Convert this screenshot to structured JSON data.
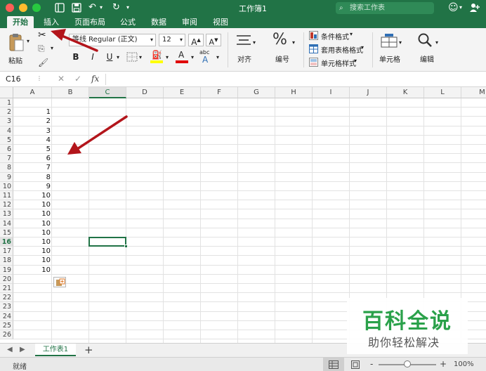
{
  "window": {
    "title": "工作簿1",
    "search_placeholder": "搜索工作表",
    "emoji_icon": "smiley-icon",
    "share_icon": "add-person-icon"
  },
  "tabs": [
    "开始",
    "插入",
    "页面布局",
    "公式",
    "数据",
    "审阅",
    "视图"
  ],
  "ribbon": {
    "paste_label": "粘贴",
    "font_name": "等线 Regular (正文)",
    "font_size": "12",
    "grow_font": "A",
    "shrink_font": "A",
    "bold": "B",
    "italic": "I",
    "underline": "U",
    "align_label": "对齐",
    "number_label": "编号",
    "number_symbol": "%",
    "conditional_format": "条件格式",
    "table_format": "套用表格格式",
    "cell_styles": "单元格样式",
    "cells_label": "单元格",
    "edit_label": "编辑",
    "abc_label": "abc"
  },
  "formula_bar": {
    "name_box": "C16",
    "fx": "fx",
    "formula": ""
  },
  "grid": {
    "columns": [
      "A",
      "B",
      "C",
      "D",
      "E",
      "F",
      "G",
      "H",
      "I",
      "J",
      "K",
      "L",
      "M"
    ],
    "selected_column": "C",
    "selected_row": 16,
    "rows": [
      "1",
      "2",
      "3",
      "4",
      "5",
      "6",
      "7",
      "8",
      "9",
      "10",
      "11",
      "12",
      "13",
      "14",
      "15",
      "16",
      "17",
      "18",
      "19",
      "20",
      "21",
      "22",
      "23",
      "24",
      "25",
      "26"
    ],
    "col_a_values": [
      "",
      "1",
      "2",
      "3",
      "4",
      "5",
      "6",
      "7",
      "8",
      "9",
      "10",
      "10",
      "10",
      "10",
      "10",
      "10",
      "10",
      "10",
      "10",
      "",
      "",
      "",
      "",
      "",
      "",
      ""
    ]
  },
  "sheets": {
    "active": "工作表1",
    "add": "+"
  },
  "status": {
    "ready": "就绪",
    "zoom": "100%",
    "zoom_minus": "-",
    "zoom_plus": "+"
  },
  "watermark": {
    "title": "百科全说",
    "subtitle": "助你轻松解决"
  },
  "colors": {
    "accent": "#217346",
    "arrow": "#b3151b"
  }
}
